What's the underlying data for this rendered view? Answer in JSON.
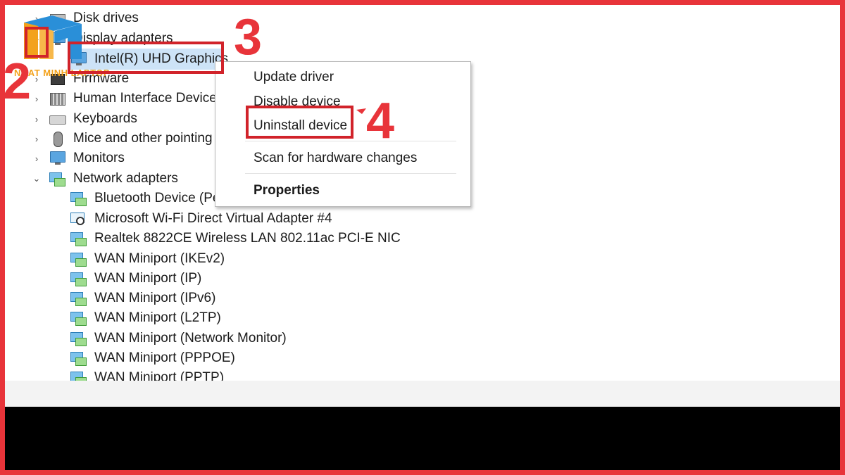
{
  "tree": {
    "rows": [
      {
        "label": "Disk drives",
        "icon": "disk-icon",
        "expander": "collapsed"
      },
      {
        "label": "Display adapters",
        "icon": "monitor-icon",
        "expander": "expanded"
      },
      {
        "label": "Intel(R) UHD Graphics",
        "icon": "monitor-icon",
        "expander": "none"
      },
      {
        "label": "Firmware",
        "icon": "chip-icon",
        "expander": "collapsed"
      },
      {
        "label": "Human Interface Devices",
        "icon": "hid-icon",
        "expander": "collapsed"
      },
      {
        "label": "Keyboards",
        "icon": "keyboard-icon",
        "expander": "collapsed"
      },
      {
        "label": "Mice and other pointing",
        "icon": "mouse-icon",
        "expander": "collapsed"
      },
      {
        "label": "Monitors",
        "icon": "monitor-icon",
        "expander": "collapsed"
      },
      {
        "label": "Network adapters",
        "icon": "network-icon",
        "expander": "expanded"
      },
      {
        "label": "Bluetooth Device (Per",
        "icon": "network-icon",
        "expander": "none"
      },
      {
        "label": "Microsoft Wi-Fi Direct Virtual Adapter #4",
        "icon": "wifi-adapter-icon",
        "expander": "none"
      },
      {
        "label": "Realtek 8822CE Wireless LAN 802.11ac PCI-E NIC",
        "icon": "network-icon",
        "expander": "none"
      },
      {
        "label": "WAN Miniport (IKEv2)",
        "icon": "network-icon",
        "expander": "none"
      },
      {
        "label": "WAN Miniport (IP)",
        "icon": "network-icon",
        "expander": "none"
      },
      {
        "label": "WAN Miniport (IPv6)",
        "icon": "network-icon",
        "expander": "none"
      },
      {
        "label": "WAN Miniport (L2TP)",
        "icon": "network-icon",
        "expander": "none"
      },
      {
        "label": "WAN Miniport (Network Monitor)",
        "icon": "network-icon",
        "expander": "none"
      },
      {
        "label": "WAN Miniport (PPPOE)",
        "icon": "network-icon",
        "expander": "none"
      },
      {
        "label": "WAN Miniport (PPTP)",
        "icon": "network-icon",
        "expander": "none"
      }
    ],
    "selected": "Intel(R) UHD Graphics"
  },
  "context_menu": {
    "items": [
      "Update driver",
      "Disable device",
      "Uninstall device",
      "Scan for hardware changes",
      "Properties"
    ]
  },
  "callouts": {
    "step2": "2",
    "step3": "3",
    "step4": "4"
  },
  "logo": {
    "text": "NHAT MINH LAPTOP"
  },
  "colors": {
    "callout": "#e8343a",
    "box": "#d1232a",
    "selection": "#cde3f7",
    "logo_orange": "#f3a21c",
    "logo_blue": "#2a8fd8"
  }
}
